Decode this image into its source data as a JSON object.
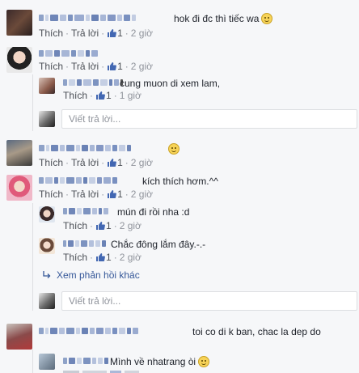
{
  "labels": {
    "like": "Thích",
    "reply": "Trả lời",
    "sep": "·",
    "write_reply_placeholder": "Viết trả lời...",
    "view_more_replies": "Xem phản hồi khác"
  },
  "comments": [
    {
      "text": "hok đi đc thì tiếc wa",
      "likes": "1",
      "time": "2 giờ",
      "emoji": "smile-emoji"
    },
    {
      "text": "",
      "likes": "1",
      "time": "2 giờ"
    },
    {
      "text": "cung muon di xem lam,",
      "likes": "1",
      "time": "1 giờ"
    },
    {
      "text": "",
      "likes": "1",
      "time": "2 giờ",
      "emoji": "smile-emoji"
    },
    {
      "text": "kích thích hơm.^^",
      "likes": "1",
      "time": "2 giờ"
    },
    {
      "text": "mún đi rồi nha :d",
      "likes": "1",
      "time": "2 giờ"
    },
    {
      "text": "Chắc đông lắm đây.-.-",
      "likes": "1",
      "time": "2 giờ"
    },
    {
      "text": "toi co di k ban, chac la dep do",
      "likes": "",
      "time": ""
    },
    {
      "text": "Mình về nhatrang òi",
      "likes": "",
      "time": "",
      "emoji": "smile-emoji"
    }
  ],
  "colors": {
    "link": "#365899",
    "like_blue": "#4267b2",
    "border": "#dddfe2",
    "background": "#f6f7f9"
  }
}
